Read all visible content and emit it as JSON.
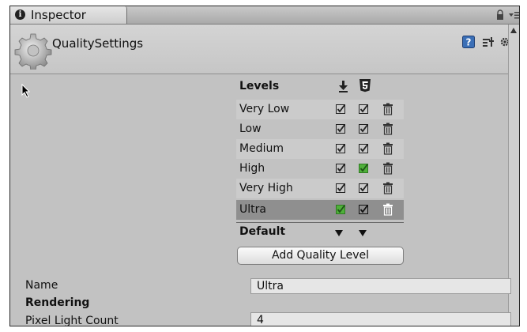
{
  "tab": {
    "title": "Inspector",
    "info_icon": "info-icon"
  },
  "header": {
    "title": "QualitySettings",
    "icons": [
      "gear-asset-icon",
      "help-icon",
      "preset-icon",
      "settings-gear-icon"
    ]
  },
  "levels": {
    "title": "Levels",
    "column_icons": [
      "download-icon",
      "html5-icon"
    ],
    "rows": [
      {
        "name": "Very Low",
        "col1": "checked",
        "col2": "checked"
      },
      {
        "name": "Low",
        "col1": "checked",
        "col2": "checked"
      },
      {
        "name": "Medium",
        "col1": "checked",
        "col2": "checked"
      },
      {
        "name": "High",
        "col1": "checked",
        "col2": "checked-default"
      },
      {
        "name": "Very High",
        "col1": "checked",
        "col2": "checked"
      },
      {
        "name": "Ultra",
        "col1": "checked-default",
        "col2": "checked",
        "selected": true
      }
    ],
    "default_label": "Default",
    "add_button": "Add Quality Level"
  },
  "properties": {
    "name_label": "Name",
    "name_value": "Ultra",
    "rendering_label": "Rendering",
    "pixel_light_count_label": "Pixel Light Count",
    "pixel_light_count_value": "4"
  },
  "colors": {
    "default_check": "#4fb03a",
    "selected_row": "#8f8f8f",
    "panel_bg": "#c2c2c2"
  }
}
